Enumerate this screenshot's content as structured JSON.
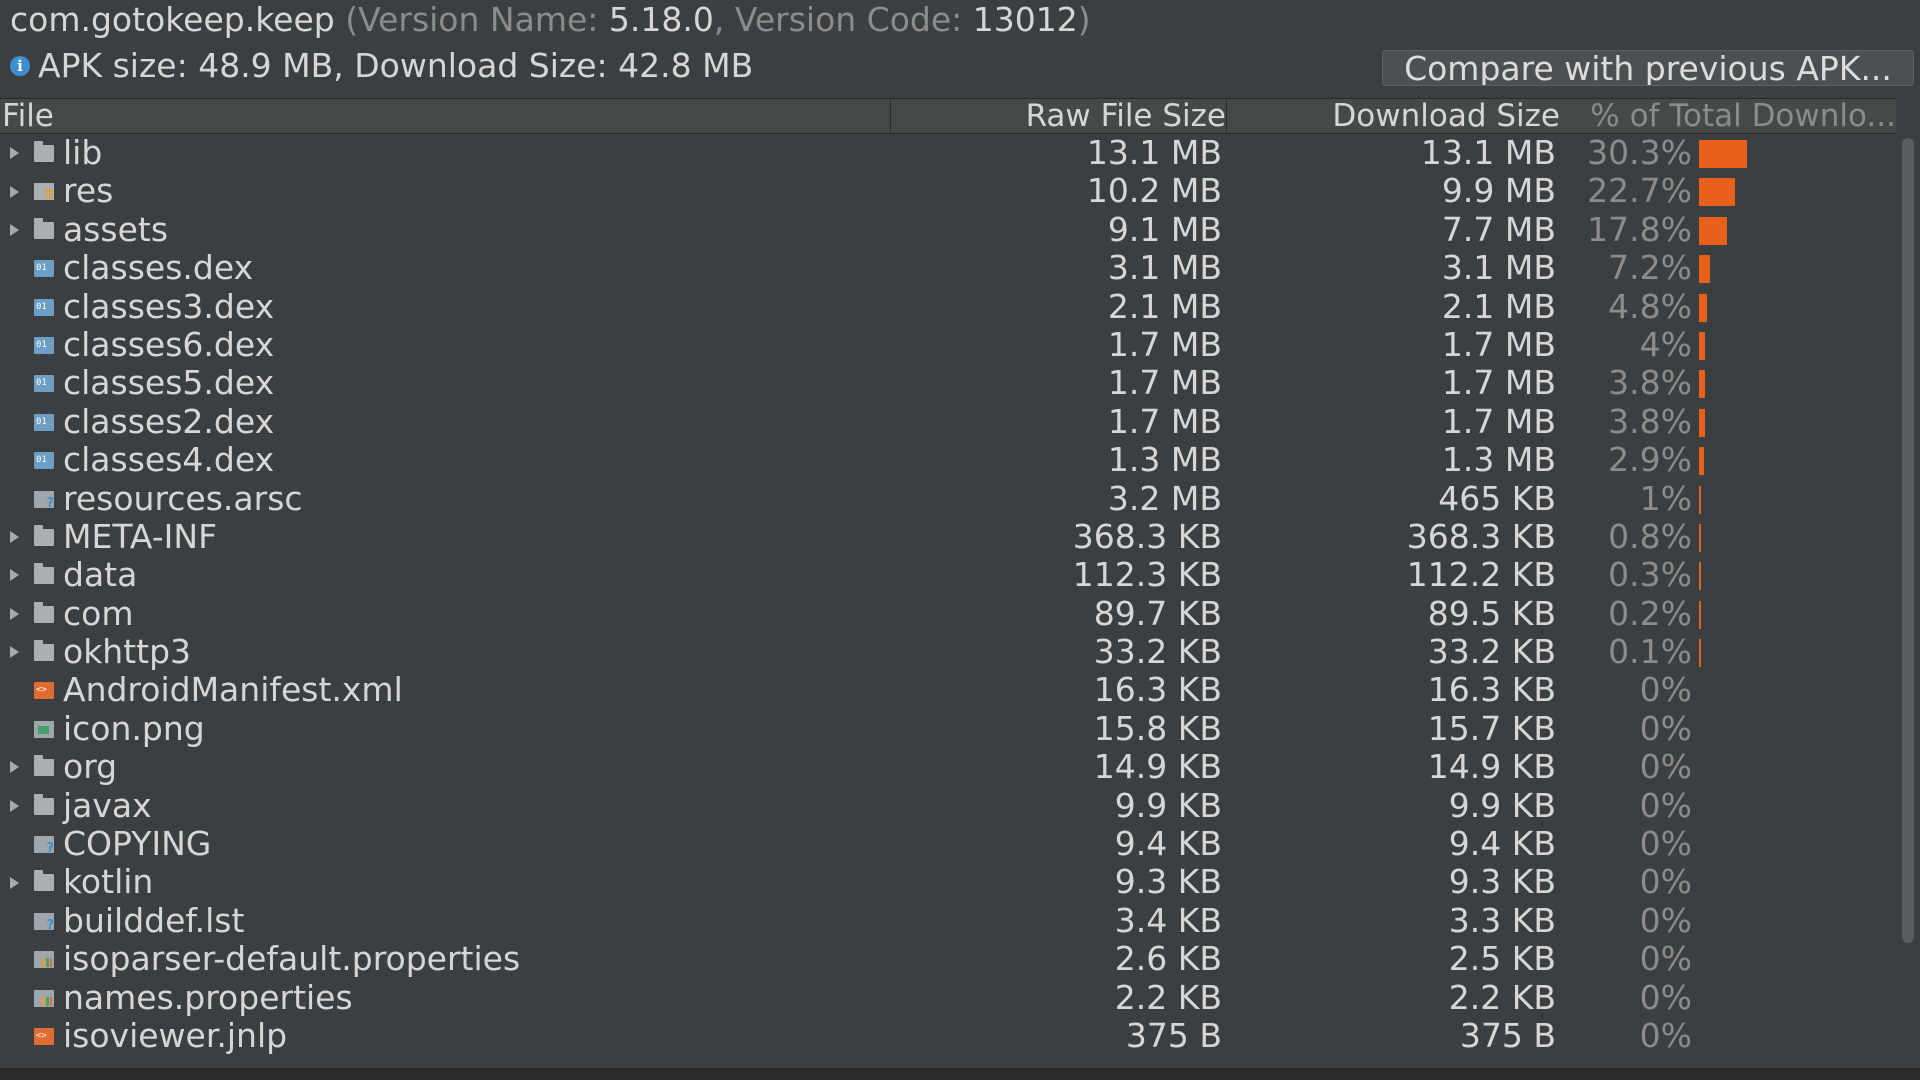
{
  "header": {
    "package": "com.gotokeep.keep",
    "paren_open": " (Version Name: ",
    "version_name": "5.18.0",
    "sep": ", Version Code: ",
    "version_code": "13012",
    "paren_close": ")",
    "apk_size_text": "APK size: 48.9 MB, Download Size: 42.8 MB",
    "compare_button": "Compare with previous APK..."
  },
  "columns": {
    "file": "File",
    "raw": "Raw File Size",
    "download": "Download Size",
    "percent": "% of Total Downlo..."
  },
  "rows": [
    {
      "name": "lib",
      "icon": "folder-icon",
      "expandable": true,
      "raw": "13.1 MB",
      "download": "13.1 MB",
      "percent": "30.3%",
      "fraction": 0.303
    },
    {
      "name": "res",
      "icon": "resource-folder-icon",
      "expandable": true,
      "raw": "10.2 MB",
      "download": "9.9 MB",
      "percent": "22.7%",
      "fraction": 0.227
    },
    {
      "name": "assets",
      "icon": "folder-icon",
      "expandable": true,
      "raw": "9.1 MB",
      "download": "7.7 MB",
      "percent": "17.8%",
      "fraction": 0.178
    },
    {
      "name": "classes.dex",
      "icon": "dex-file-icon",
      "expandable": false,
      "raw": "3.1 MB",
      "download": "3.1 MB",
      "percent": "7.2%",
      "fraction": 0.072
    },
    {
      "name": "classes3.dex",
      "icon": "dex-file-icon",
      "expandable": false,
      "raw": "2.1 MB",
      "download": "2.1 MB",
      "percent": "4.8%",
      "fraction": 0.048
    },
    {
      "name": "classes6.dex",
      "icon": "dex-file-icon",
      "expandable": false,
      "raw": "1.7 MB",
      "download": "1.7 MB",
      "percent": "4%",
      "fraction": 0.04
    },
    {
      "name": "classes5.dex",
      "icon": "dex-file-icon",
      "expandable": false,
      "raw": "1.7 MB",
      "download": "1.7 MB",
      "percent": "3.8%",
      "fraction": 0.038
    },
    {
      "name": "classes2.dex",
      "icon": "dex-file-icon",
      "expandable": false,
      "raw": "1.7 MB",
      "download": "1.7 MB",
      "percent": "3.8%",
      "fraction": 0.038
    },
    {
      "name": "classes4.dex",
      "icon": "dex-file-icon",
      "expandable": false,
      "raw": "1.3 MB",
      "download": "1.3 MB",
      "percent": "2.9%",
      "fraction": 0.029
    },
    {
      "name": "resources.arsc",
      "icon": "unknown-file-icon",
      "expandable": false,
      "raw": "3.2 MB",
      "download": "465 KB",
      "percent": "1%",
      "fraction": 0.01
    },
    {
      "name": "META-INF",
      "icon": "folder-icon",
      "expandable": true,
      "raw": "368.3 KB",
      "download": "368.3 KB",
      "percent": "0.8%",
      "fraction": 0.008
    },
    {
      "name": "data",
      "icon": "folder-icon",
      "expandable": true,
      "raw": "112.3 KB",
      "download": "112.2 KB",
      "percent": "0.3%",
      "fraction": 0.003
    },
    {
      "name": "com",
      "icon": "folder-icon",
      "expandable": true,
      "raw": "89.7 KB",
      "download": "89.5 KB",
      "percent": "0.2%",
      "fraction": 0.002
    },
    {
      "name": "okhttp3",
      "icon": "folder-icon",
      "expandable": true,
      "raw": "33.2 KB",
      "download": "33.2 KB",
      "percent": "0.1%",
      "fraction": 0.001
    },
    {
      "name": "AndroidManifest.xml",
      "icon": "xml-file-icon",
      "expandable": false,
      "raw": "16.3 KB",
      "download": "16.3 KB",
      "percent": "0%",
      "fraction": 0
    },
    {
      "name": "icon.png",
      "icon": "image-file-icon",
      "expandable": false,
      "raw": "15.8 KB",
      "download": "15.7 KB",
      "percent": "0%",
      "fraction": 0
    },
    {
      "name": "org",
      "icon": "folder-icon",
      "expandable": true,
      "raw": "14.9 KB",
      "download": "14.9 KB",
      "percent": "0%",
      "fraction": 0
    },
    {
      "name": "javax",
      "icon": "folder-icon",
      "expandable": true,
      "raw": "9.9 KB",
      "download": "9.9 KB",
      "percent": "0%",
      "fraction": 0
    },
    {
      "name": "COPYING",
      "icon": "unknown-file-icon",
      "expandable": false,
      "raw": "9.4 KB",
      "download": "9.4 KB",
      "percent": "0%",
      "fraction": 0
    },
    {
      "name": "kotlin",
      "icon": "folder-icon",
      "expandable": true,
      "raw": "9.3 KB",
      "download": "9.3 KB",
      "percent": "0%",
      "fraction": 0
    },
    {
      "name": "builddef.lst",
      "icon": "unknown-file-icon",
      "expandable": false,
      "raw": "3.4 KB",
      "download": "3.3 KB",
      "percent": "0%",
      "fraction": 0
    },
    {
      "name": "isoparser-default.properties",
      "icon": "properties-file-icon",
      "expandable": false,
      "raw": "2.6 KB",
      "download": "2.5 KB",
      "percent": "0%",
      "fraction": 0
    },
    {
      "name": "names.properties",
      "icon": "properties-file-icon",
      "expandable": false,
      "raw": "2.2 KB",
      "download": "2.2 KB",
      "percent": "0%",
      "fraction": 0
    },
    {
      "name": "isoviewer.jnlp",
      "icon": "xml-file-icon",
      "expandable": false,
      "raw": "375 B",
      "download": "375 B",
      "percent": "0%",
      "fraction": 0
    }
  ],
  "colors": {
    "background": "#3c3f41",
    "text": "#d6d6d6",
    "muted_text": "#8c8c8c",
    "bar": "#e8611a",
    "info": "#3d8fd1"
  }
}
